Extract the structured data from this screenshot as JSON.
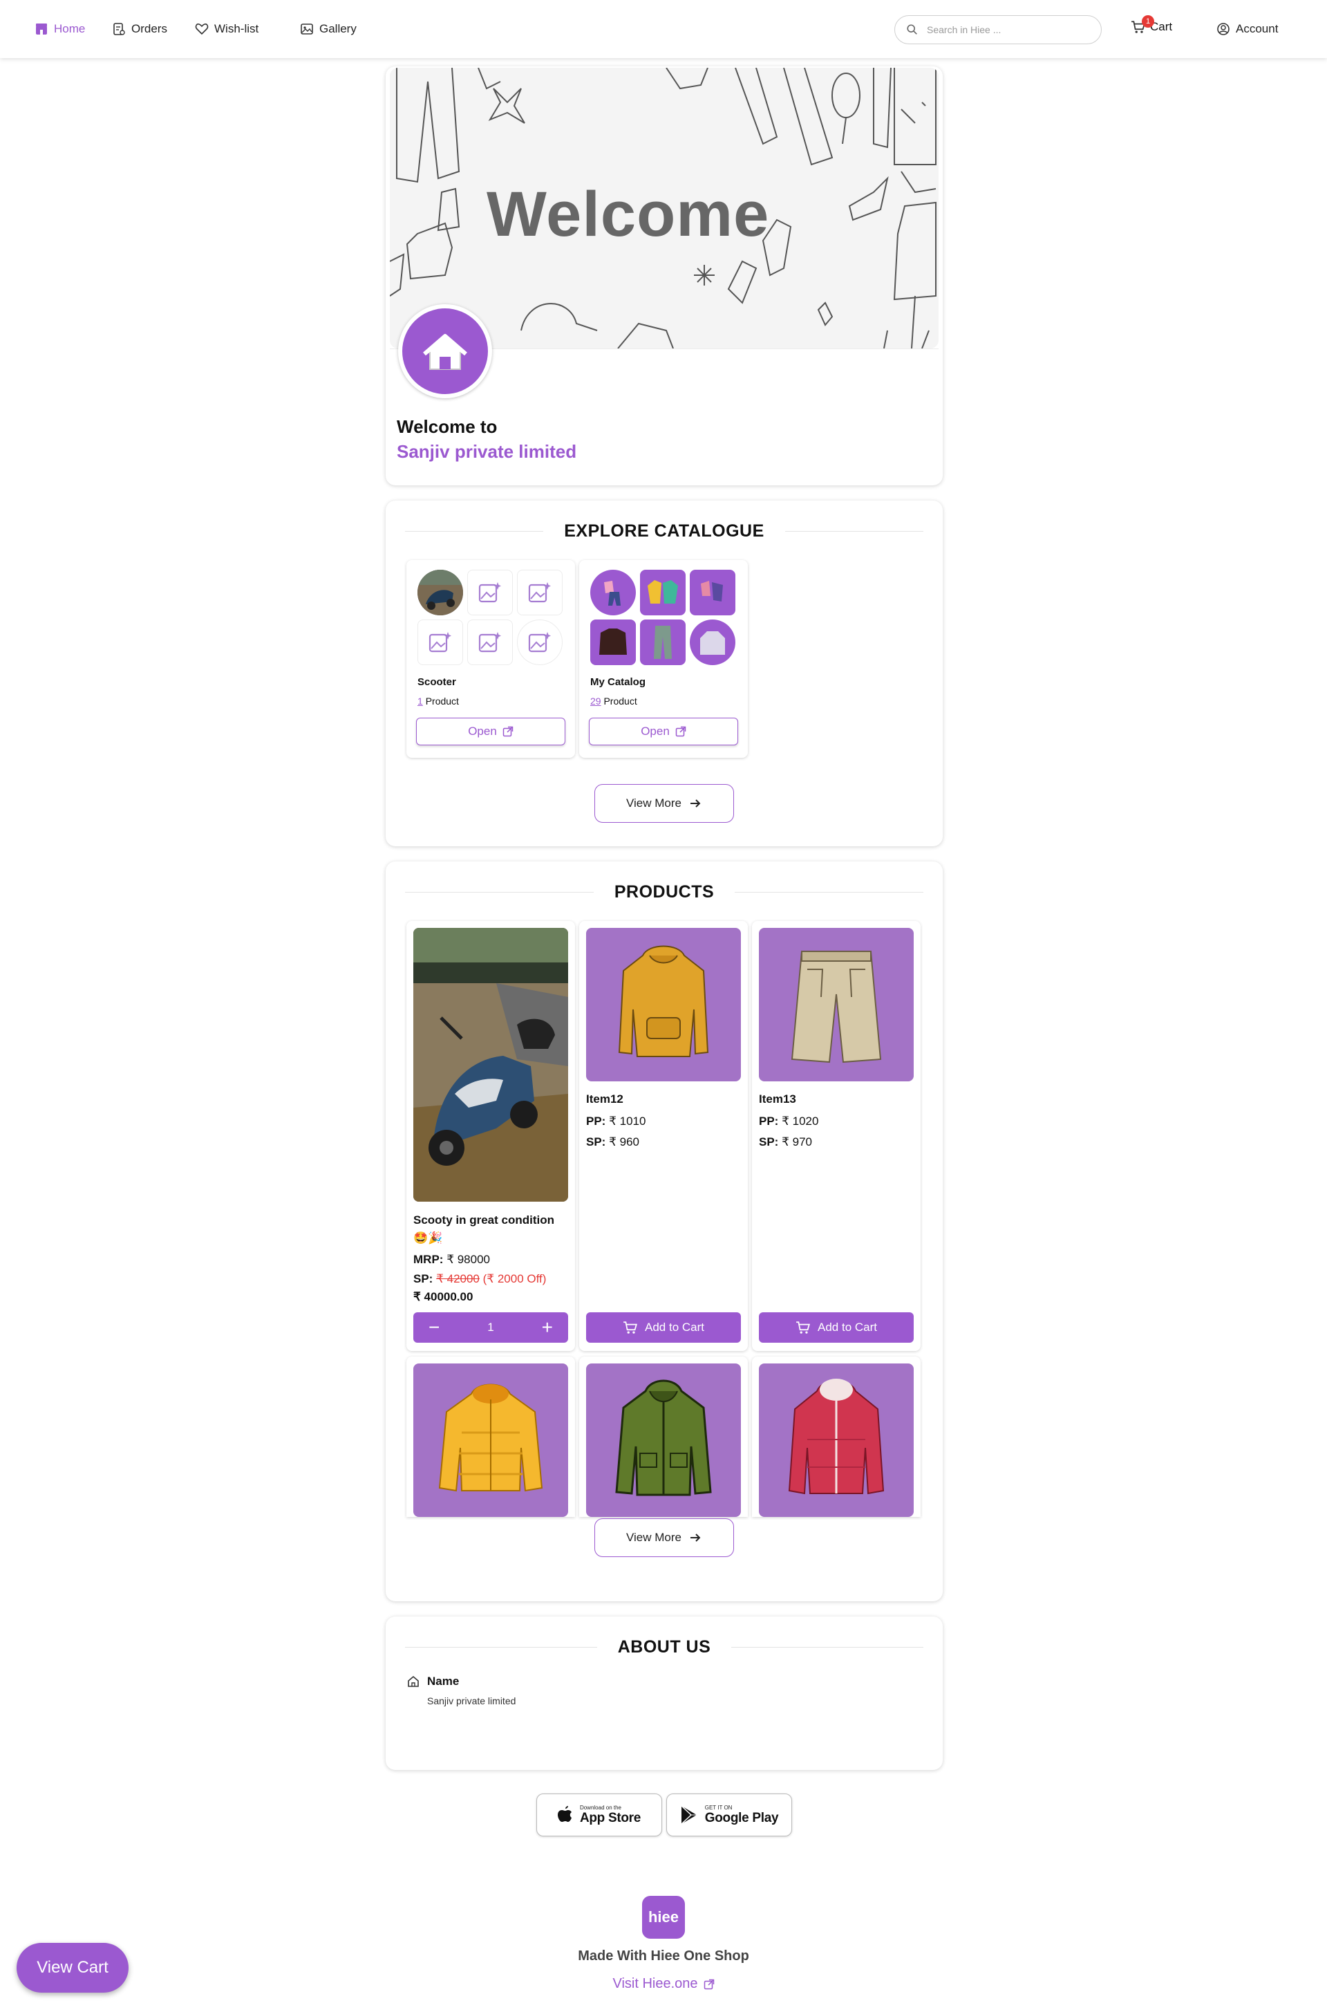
{
  "nav": {
    "home": "Home",
    "orders": "Orders",
    "wishlist": "Wish-list",
    "gallery": "Gallery",
    "search_placeholder": "Search in Hiee ...",
    "cart": "Cart",
    "cart_count": "1",
    "account": "Account"
  },
  "hero": {
    "banner_text": "Welcome",
    "welcome_to": "Welcome to",
    "store_name": "Sanjiv private limited"
  },
  "catalogue": {
    "title": "EXPLORE CATALOGUE",
    "items": [
      {
        "name": "Scooter",
        "count": "1",
        "count_label": "Product",
        "open": "Open"
      },
      {
        "name": "My Catalog",
        "count": "29",
        "count_label": "Product",
        "open": "Open"
      }
    ],
    "view_more": "View More"
  },
  "products": {
    "title": "PRODUCTS",
    "items": [
      {
        "name": "Scooty in great condition 🤩🎉",
        "mrp_label": "MRP:",
        "mrp": "₹ 98000",
        "sp_label": "SP:",
        "sp_strike": "₹ 42000",
        "discount": "(₹ 2000 Off)",
        "final": "₹ 40000.00",
        "qty": "1"
      },
      {
        "name": "Item12",
        "pp_label": "PP:",
        "pp": "₹ 1010",
        "sp_label": "SP:",
        "sp": "₹ 960",
        "button": "Add to Cart"
      },
      {
        "name": "Item13",
        "pp_label": "PP:",
        "pp": "₹ 1020",
        "sp_label": "SP:",
        "sp": "₹ 970",
        "button": "Add to Cart"
      }
    ],
    "view_more": "View More"
  },
  "about": {
    "title": "ABOUT US",
    "name_label": "Name",
    "name_value": "Sanjiv private limited"
  },
  "stores": {
    "apple_small": "Download on the",
    "apple_big": "App Store",
    "google_small": "GET IT ON",
    "google_big": "Google Play"
  },
  "footer": {
    "logo": "hiee",
    "made_with": "Made With Hiee One Shop",
    "visit": "Visit Hiee.one"
  },
  "fab": {
    "label": "View Cart"
  },
  "colors": {
    "accent": "#9b59d0",
    "product_bg": "#a373c6",
    "discount": "#e53935"
  }
}
